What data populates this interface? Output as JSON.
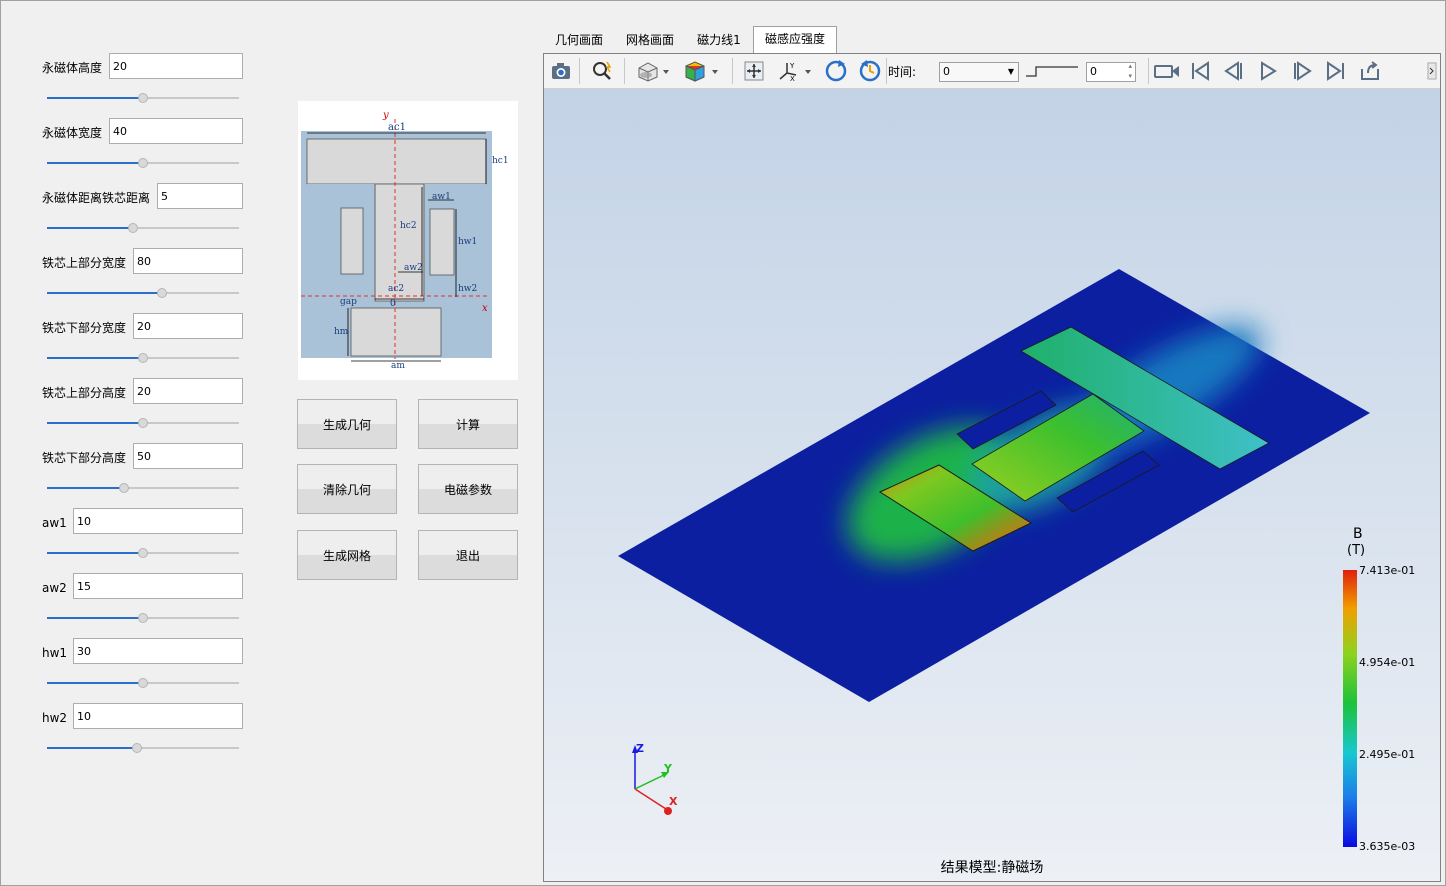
{
  "params": [
    {
      "label": "永磁体高度",
      "value": "20",
      "slider": 0.5
    },
    {
      "label": "永磁体宽度",
      "value": "40",
      "slider": 0.5
    },
    {
      "label": "永磁体距离铁芯距离",
      "value": "5",
      "slider": 0.45
    },
    {
      "label": "铁芯上部分宽度",
      "value": "80",
      "slider": 0.6
    },
    {
      "label": "铁芯下部分宽度",
      "value": "20",
      "slider": 0.5
    },
    {
      "label": "铁芯上部分高度",
      "value": "20",
      "slider": 0.5
    },
    {
      "label": "铁芯下部分高度",
      "value": "50",
      "slider": 0.4
    },
    {
      "label": "aw1",
      "value": "10",
      "slider": 0.5
    },
    {
      "label": "aw2",
      "value": "15",
      "slider": 0.5
    },
    {
      "label": "hw1",
      "value": "30",
      "slider": 0.5
    },
    {
      "label": "hw2",
      "value": "10",
      "slider": 0.47
    }
  ],
  "diagram": {
    "labels": {
      "y": "y",
      "x": "x",
      "ac1": "ac1",
      "hc1": "hc1",
      "aw1": "aw1",
      "hc2": "hc2",
      "hw1": "hw1",
      "aw2": "aw2",
      "ac2": "ac2",
      "hw2": "hw2",
      "gap": "gap",
      "origin": "0",
      "hm": "hm",
      "am": "am"
    }
  },
  "buttons": {
    "generate_geometry": "生成几何",
    "compute": "计算",
    "clear_geometry": "清除几何",
    "em_params": "电磁参数",
    "generate_mesh": "生成网格",
    "exit": "退出"
  },
  "tabs": [
    "几何画面",
    "网格画面",
    "磁力线1",
    "磁感应强度"
  ],
  "active_tab": 3,
  "toolbar": {
    "time_label": "时间:",
    "time_value": "0",
    "step_value": "0",
    "icons": [
      "camera-icon",
      "zoom-icon",
      "view-cube-icon",
      "color-cube-icon",
      "fit-view-icon",
      "axes-icon",
      "rotate-cw-icon",
      "rotate-ccw-icon",
      "video-icon",
      "skip-first-icon",
      "step-back-icon",
      "play-icon",
      "step-forward-icon",
      "skip-last-icon",
      "export-icon"
    ]
  },
  "legend": {
    "title": "B",
    "unit": "(T)",
    "ticks": [
      "7.413e-01",
      "4.954e-01",
      "2.495e-01",
      "3.635e-03"
    ]
  },
  "axes": {
    "z": "Z",
    "y": "Y",
    "x": "X"
  },
  "footer": "结果模型:静磁场"
}
